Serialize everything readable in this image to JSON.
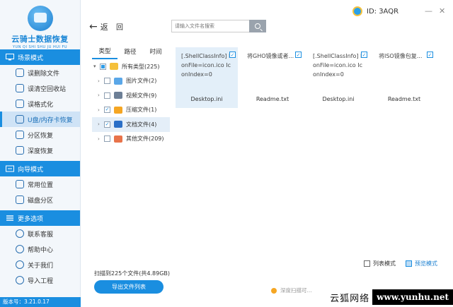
{
  "app": {
    "title": "云骑士数据恢复",
    "subtitle": "YUN QI SHI SHU JU HUI FU",
    "version_label": "版本号：3.21.0.17"
  },
  "sidebar": {
    "sections": [
      {
        "title": "场景模式",
        "items": [
          "误删除文件",
          "误清空回收站",
          "误格式化",
          "U盘/内存卡恢复",
          "分区恢复",
          "深度恢复"
        ]
      },
      {
        "title": "向导模式",
        "items": [
          "常用位置",
          "磁盘分区"
        ]
      },
      {
        "title": "更多选项",
        "items": [
          "联系客服",
          "帮助中心",
          "关于我们",
          "导入工程"
        ]
      }
    ],
    "active_item": "U盘/内存卡恢复"
  },
  "topbar": {
    "back_label": "返",
    "home_label": "回",
    "search_placeholder": "请输入文件名搜索",
    "user_id": "ID: 3AQR"
  },
  "tree": {
    "tabs": [
      "类型",
      "路径",
      "时间"
    ],
    "rows": [
      {
        "label": "所有类型(225)",
        "state": "partial",
        "icon": "folder-icon",
        "color": "#f5c03a"
      },
      {
        "label": "图片文件(2)",
        "state": "unchecked",
        "icon": "image-icon",
        "color": "#5aa7e8"
      },
      {
        "label": "视频文件(9)",
        "state": "unchecked",
        "icon": "video-icon",
        "color": "#6d7f96"
      },
      {
        "label": "压缩文件(1)",
        "state": "checked",
        "icon": "archive-icon",
        "color": "#f5a623"
      },
      {
        "label": "文档文件(4)",
        "state": "checked",
        "icon": "document-icon",
        "color": "#2b6fc7"
      },
      {
        "label": "其他文件(209)",
        "state": "unchecked",
        "icon": "other-files-icon",
        "color": "#e8734a"
      }
    ],
    "scan_summary": "扫描到225个文件(共4.89GB)",
    "export_label": "导出文件列表"
  },
  "files": [
    {
      "preview": "[.ShellClassInfo] IconFile=icon.ico IconIndex=0",
      "name": "Desktop.ini",
      "checked": true
    },
    {
      "preview": "将GHO镜像或者...",
      "name": "Readme.txt",
      "checked": true
    },
    {
      "preview": "[.ShellClassInfo] IconFile=icon.ico IconIndex=0",
      "name": "Desktop.ini",
      "checked": true
    },
    {
      "preview": "将ISO镜像包复...",
      "name": "Readme.txt",
      "checked": true
    }
  ],
  "view_modes": {
    "list_label": "列表模式",
    "preview_label": "预览模式"
  },
  "deep_scan_hint": "深度扫描可...",
  "watermark": {
    "left": "云狐网络",
    "right": "www.yunhu.net"
  },
  "colors": {
    "accent": "#1a8ee0",
    "active_bg": "#cfe3f6",
    "selected_tile": "#e3eff9"
  }
}
